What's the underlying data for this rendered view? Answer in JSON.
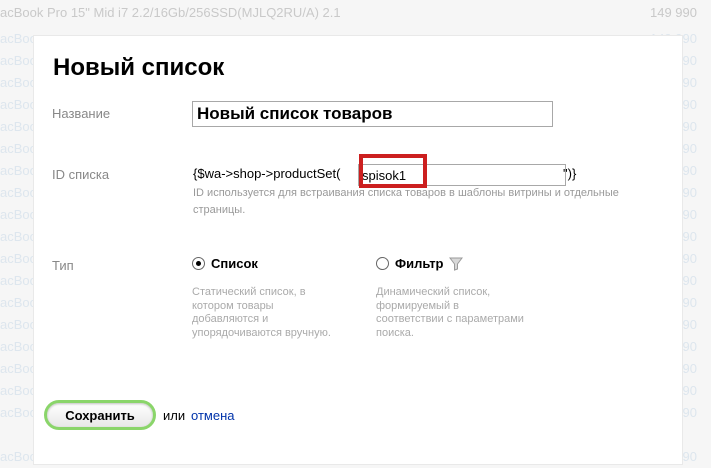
{
  "background": {
    "rows": [
      {
        "name": "acBook Pro 15\" Mid i7 2.2/16Gb/256SSD(MJLQ2RU/A) 2.1",
        "price": "149 990"
      },
      {
        "name": "acBoo",
        "price": "149 990"
      },
      {
        "name": "acBoo",
        "price": "149 990"
      },
      {
        "name": "acBoo",
        "price": "149 990"
      },
      {
        "name": "acBoo",
        "price": "149 990"
      },
      {
        "name": "acBoo",
        "price": "149 990"
      },
      {
        "name": "acBoo",
        "price": "149 990"
      },
      {
        "name": "acBoo",
        "price": "149 990"
      },
      {
        "name": "acBoo",
        "price": "149 990"
      },
      {
        "name": "acBoo",
        "price": "149 990"
      },
      {
        "name": "acBoo",
        "price": "149 990"
      },
      {
        "name": "acBoo",
        "price": "149 990"
      },
      {
        "name": "acBoo",
        "price": "149 990"
      },
      {
        "name": "acBoo",
        "price": "149 990"
      },
      {
        "name": "acBoo",
        "price": "149 990"
      },
      {
        "name": "acBoo",
        "price": "149 990"
      },
      {
        "name": "acBoo",
        "price": "149 990"
      },
      {
        "name": "acBoo",
        "price": "149 990"
      },
      {
        "name": "acBoo",
        "price": "149 990"
      },
      {
        "name": "acBook Pro 15\" Mid i7 2.2/16Gb/256SSD(MJLQ2RU/A)",
        "price": "149 990"
      }
    ]
  },
  "dialog": {
    "title": "Новый список",
    "name_label": "Название",
    "name_value": "Новый список товаров",
    "id_label": "ID списка",
    "id_prefix": "{$wa->shop->productSet(",
    "id_value": "spisok1",
    "id_suffix": "\")}",
    "id_hint": "ID используется для встраивания списка товаров в шаблоны витрины и отдельные страницы.",
    "type_label": "Тип",
    "types": [
      {
        "label": "Список",
        "selected": true,
        "description": "Статический список, в котором товары добавляются и упорядочиваются вручную.",
        "icon": ""
      },
      {
        "label": "Фильтр",
        "selected": false,
        "description": "Динамический список, формируемый в соответствии с параметрами поиска.",
        "icon": "filter-funnel-icon"
      }
    ],
    "save_label": "Сохранить",
    "or_text": "или",
    "cancel_label": "отмена"
  },
  "colors": {
    "highlight": "#cc1f1f",
    "save_border": "#8ad56a",
    "link": "#0033aa"
  }
}
